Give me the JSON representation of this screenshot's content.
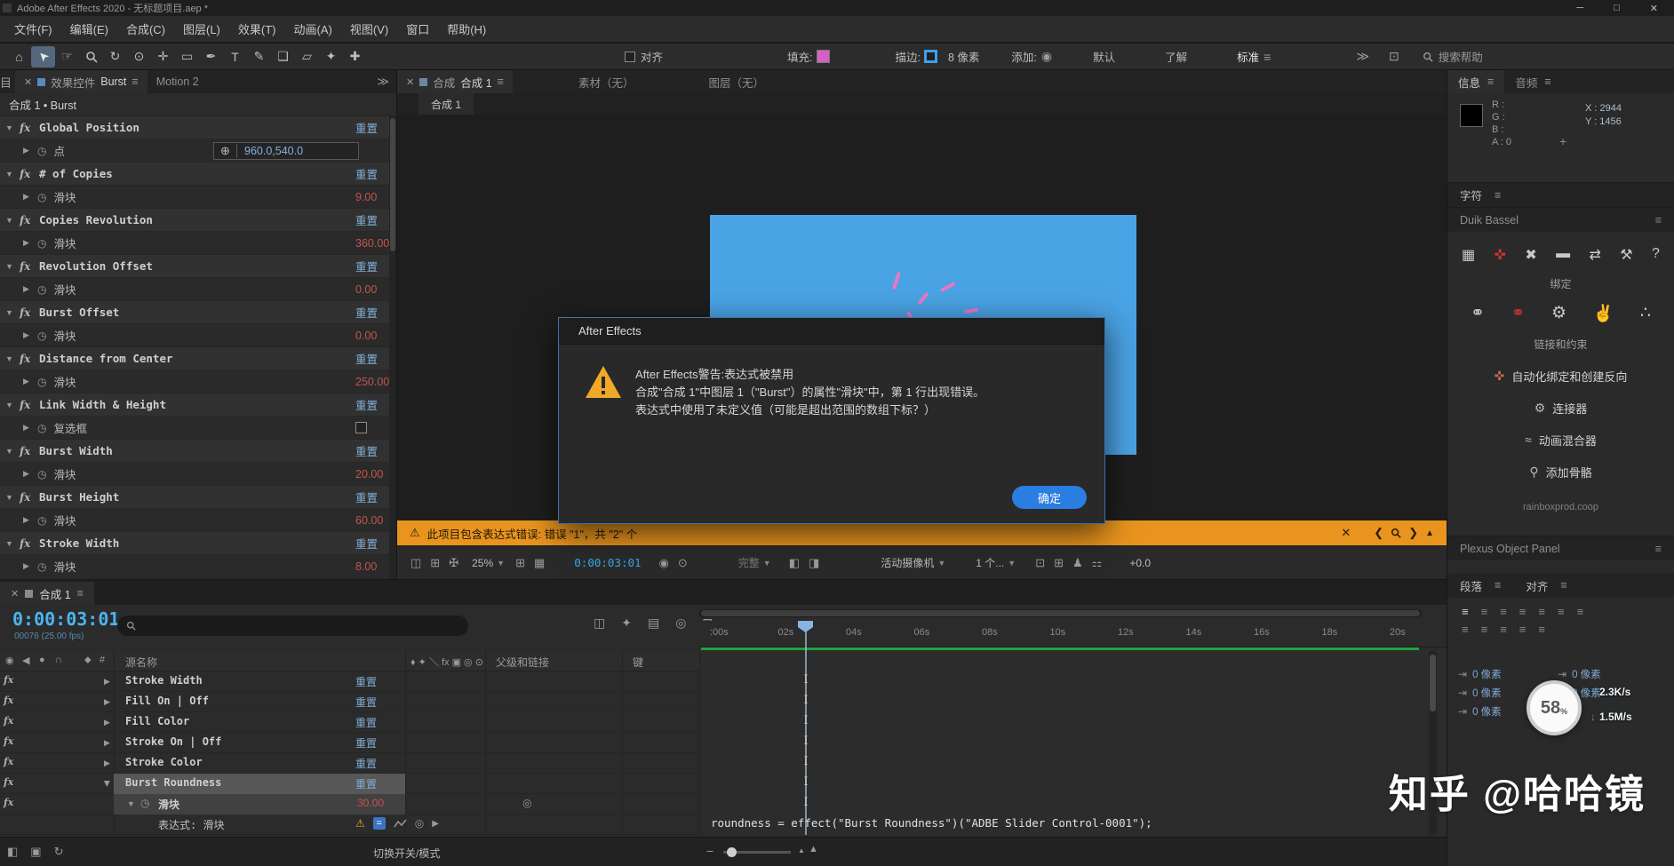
{
  "colors": {
    "accent_blue": "#2a7de1",
    "link_blue": "#82aed6",
    "value_red": "#c3554f",
    "value_blue": "#7fb2e0",
    "timecode_cyan": "#4cb4f0",
    "warning_orange": "#e8941e",
    "comp_blue": "#4aa3e4",
    "burst_pink": "#e878c8",
    "render_green": "#21a23c",
    "net_up_blue": "#2bb7f5",
    "net_down_green": "#3ec04e"
  },
  "title_bar": {
    "title": "Adobe After Effects 2020 - 无标题项目.aep *"
  },
  "menu_bar": {
    "items": [
      "文件(F)",
      "编辑(E)",
      "合成(C)",
      "图层(L)",
      "效果(T)",
      "动画(A)",
      "视图(V)",
      "窗口",
      "帮助(H)"
    ]
  },
  "toolbar": {
    "snap_label": "对齐",
    "fill_label": "填充:",
    "stroke_label": "描边:",
    "stroke_width": "8 像素",
    "add_label": "添加:",
    "workspace_default": "默认",
    "workspace_learn": "了解",
    "workspace_standard": "标准",
    "search_help": "搜索帮助"
  },
  "effect_controls": {
    "clipped_tab": "项目",
    "panel_label": "效果控件",
    "comp_ref": "Burst",
    "other_tab": "Motion 2",
    "breadcrumb": "合成 1 • Burst",
    "effects": [
      {
        "name": "Global Position",
        "reset": "重置",
        "param": "点",
        "value": "960.0,540.0",
        "type": "point"
      },
      {
        "name": "# of Copies",
        "reset": "重置",
        "param": "滑块",
        "value": "9.00",
        "type": "slider"
      },
      {
        "name": "Copies Revolution",
        "reset": "重置",
        "param": "滑块",
        "value": "360.00",
        "type": "slider"
      },
      {
        "name": "Revolution Offset",
        "reset": "重置",
        "param": "滑块",
        "value": "0.00",
        "type": "slider"
      },
      {
        "name": "Burst Offset",
        "reset": "重置",
        "param": "滑块",
        "value": "0.00",
        "type": "slider"
      },
      {
        "name": "Distance from Center",
        "reset": "重置",
        "param": "滑块",
        "value": "250.00",
        "type": "slider"
      },
      {
        "name": "Link Width & Height",
        "reset": "重置",
        "param": "复选框",
        "value": "",
        "type": "checkbox"
      },
      {
        "name": "Burst Width",
        "reset": "重置",
        "param": "滑块",
        "value": "20.00",
        "type": "slider"
      },
      {
        "name": "Burst Height",
        "reset": "重置",
        "param": "滑块",
        "value": "60.00",
        "type": "slider"
      },
      {
        "name": "Stroke Width",
        "reset": "重置",
        "param": "滑块",
        "value": "8.00",
        "type": "slider"
      }
    ]
  },
  "composition": {
    "panel_label": "合成",
    "active_tab": "合成 1",
    "footage_tab": "素材（无）",
    "layer_tab": "图层（无）",
    "mini_tab": "合成 1"
  },
  "dialog": {
    "title": "After Effects",
    "line1": "After Effects警告:表达式被禁用",
    "line2": "合成\"合成 1\"中图层 1（\"Burst\"）的属性\"滑块\"中，第 1 行出现错误。",
    "line3": "表达式中使用了未定义值（可能是超出范围的数组下标？）",
    "ok": "确定"
  },
  "warning_bar": {
    "message": "此项目包含表达式错误: 错误 \"1\"，共 \"2\" 个"
  },
  "viewer_bar": {
    "zoom": "25%",
    "timecode": "0:00:03:01",
    "resolution": "完整",
    "camera": "活动摄像机",
    "views": "1 个...",
    "exposure": "+0.0"
  },
  "timeline": {
    "tab": "合成 1",
    "timecode": "0:00:03:01",
    "frame_info": "00076 (25.00 fps)",
    "col_source": "源名称",
    "col_parent": "父级和链接",
    "col_key": "键",
    "rows": [
      {
        "name": "Stroke Width",
        "reset": "重置"
      },
      {
        "name": "Fill On | Off",
        "reset": "重置"
      },
      {
        "name": "Fill Color",
        "reset": "重置"
      },
      {
        "name": "Stroke On | Off",
        "reset": "重置"
      },
      {
        "name": "Stroke Color",
        "reset": "重置"
      },
      {
        "name": "Burst Roundness",
        "reset": "重置",
        "selected": true
      }
    ],
    "slider_row": {
      "name": "滑块",
      "value": "30.00"
    },
    "expression_row": {
      "name": "表达式: 滑块"
    },
    "ruler": [
      ":00s",
      "02s",
      "04s",
      "06s",
      "08s",
      "10s",
      "12s",
      "14s",
      "16s",
      "18s",
      "20s"
    ],
    "expression_text": "roundness = effect(\"Burst Roundness\")(\"ADBE Slider Control-0001\");"
  },
  "status_bar": {
    "toggle_label": "切换开关/模式"
  },
  "right_panel": {
    "info_tab": "信息",
    "audio_tab": "音频",
    "info": {
      "r": "R :",
      "g": "G :",
      "b": "B :",
      "a": "A : 0",
      "x": "X : 2944",
      "y": "Y : 1456"
    },
    "character_tab": "字符",
    "duik": {
      "title": "Duik Bassel",
      "section1": "绑定",
      "section2": "链接和约束",
      "btn_autorig": "自动化绑定和创建反向",
      "btn_connector": "连接器",
      "btn_mixer": "动画混合器",
      "btn_bones": "添加骨骼",
      "footer": "rainboxprod.coop"
    },
    "plexus_tab": "Plexus Object Panel",
    "paragraph_tab": "段落",
    "align_tab": "对齐",
    "indent_fields": [
      "0 像素",
      "0 像素",
      "0 像素",
      "0 像素",
      "0 像素"
    ],
    "network": {
      "percent": "58",
      "unit": "%",
      "up": "2.3K/s",
      "down": "1.5M/s"
    }
  },
  "watermark": "知乎 @哈哈镜"
}
